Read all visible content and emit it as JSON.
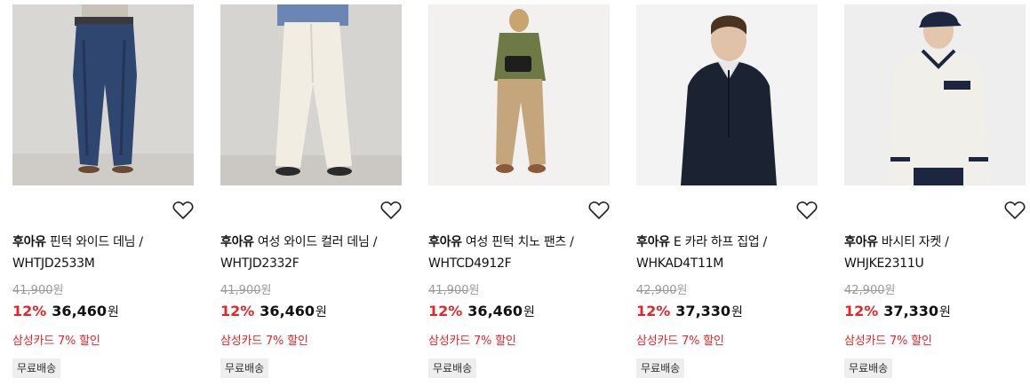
{
  "currency": "원",
  "products": [
    {
      "brand": "후아유",
      "name": "핀턱 와이드 데님 / WHTJD2533M",
      "original_price": "41,900",
      "discount_rate": "12%",
      "price": "36,460",
      "card_promo": "삼성카드 7% 할인",
      "shipping_badge": "무료배송"
    },
    {
      "brand": "후아유",
      "name": "여성 와이드 컬러 데님 / WHTJD2332F",
      "original_price": "41,900",
      "discount_rate": "12%",
      "price": "36,460",
      "card_promo": "삼성카드 7% 할인",
      "shipping_badge": "무료배송"
    },
    {
      "brand": "후아유",
      "name": "여성 핀턱 치노 팬츠 / WHTCD4912F",
      "original_price": "41,900",
      "discount_rate": "12%",
      "price": "36,460",
      "card_promo": "삼성카드 7% 할인",
      "shipping_badge": "무료배송"
    },
    {
      "brand": "후아유",
      "name": "E 카라 하프 집업 / WHKAD4T11M",
      "original_price": "42,900",
      "discount_rate": "12%",
      "price": "37,330",
      "card_promo": "삼성카드 7% 할인",
      "shipping_badge": "무료배송"
    },
    {
      "brand": "후아유",
      "name": "바시티 자켓 / WHJKE2311U",
      "original_price": "42,900",
      "discount_rate": "12%",
      "price": "37,330",
      "card_promo": "삼성카드 7% 할인",
      "shipping_badge": "무료배송"
    }
  ]
}
